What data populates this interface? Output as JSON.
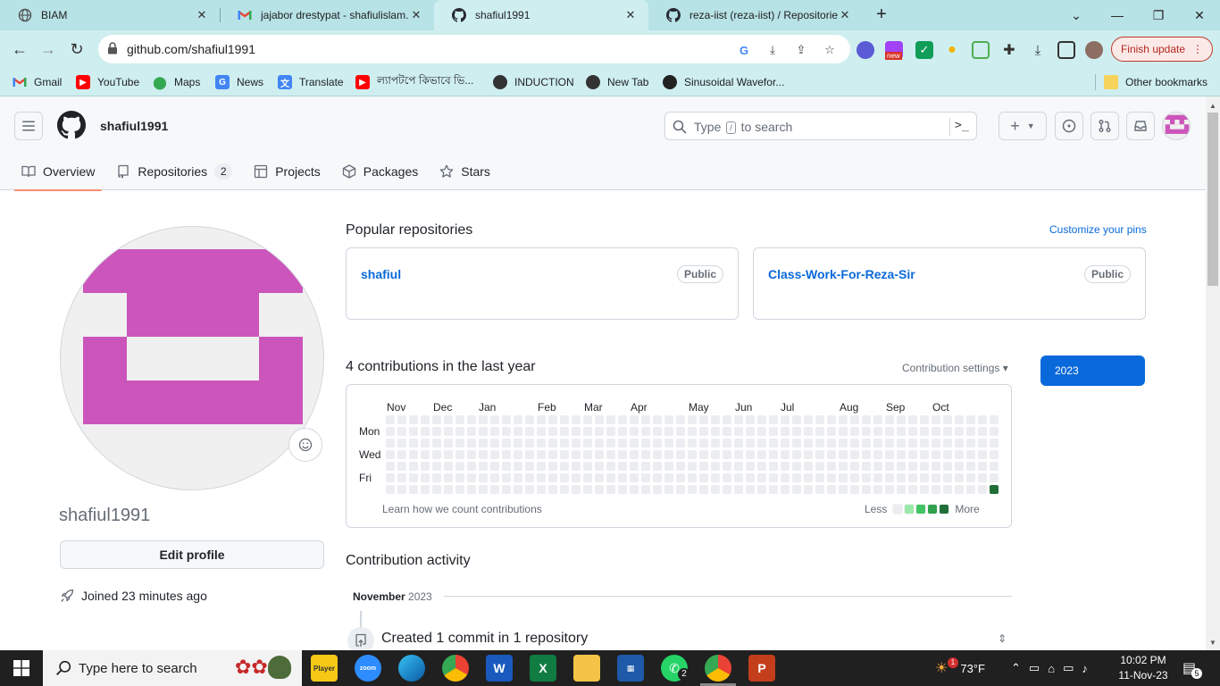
{
  "browser": {
    "tabs": [
      {
        "title": "BIAM",
        "icon": "globe-icon"
      },
      {
        "title": "jajabor drestypat - shafiulislam.m",
        "icon": "gmail-icon"
      },
      {
        "title": "shafiul1991",
        "icon": "github-icon",
        "active": true
      },
      {
        "title": "reza-iist (reza-iist) / Repositories",
        "icon": "github-icon"
      }
    ],
    "url": "github.com/shafiul1991",
    "finish_update": "Finish update",
    "bookmarks": [
      {
        "label": "Gmail",
        "icon": "gmail-icon"
      },
      {
        "label": "YouTube",
        "icon": "youtube-icon"
      },
      {
        "label": "Maps",
        "icon": "maps-icon"
      },
      {
        "label": "News",
        "icon": "news-icon"
      },
      {
        "label": "Translate",
        "icon": "translate-icon"
      },
      {
        "label": "ল্যাপটপে কিভাবে ভি...",
        "icon": "youtube-icon"
      },
      {
        "label": "INDUCTION",
        "icon": "globe-icon"
      },
      {
        "label": "New Tab",
        "icon": "globe-icon"
      },
      {
        "label": "Sinusoidal Wavefor...",
        "icon": "globe-icon"
      }
    ],
    "other_bookmarks": "Other bookmarks",
    "ext_badge": "new"
  },
  "github": {
    "username": "shafiul1991",
    "search_prefix": "Type",
    "search_key": "/",
    "search_suffix": "to search",
    "tabs": [
      {
        "label": "Overview",
        "icon": "book-icon"
      },
      {
        "label": "Repositories",
        "icon": "repo-icon",
        "count": "2"
      },
      {
        "label": "Projects",
        "icon": "table-icon"
      },
      {
        "label": "Packages",
        "icon": "package-icon"
      },
      {
        "label": "Stars",
        "icon": "star-icon"
      }
    ]
  },
  "profile": {
    "login": "shafiul1991",
    "edit_profile": "Edit profile",
    "joined": "Joined 23 minutes ago"
  },
  "main": {
    "popular_title": "Popular repositories",
    "customize_pins": "Customize your pins",
    "pins": [
      {
        "name": "shafiul",
        "visibility": "Public"
      },
      {
        "name": "Class-Work-For-Reza-Sir",
        "visibility": "Public"
      }
    ],
    "contrib_title": "4 contributions in the last year",
    "contrib_settings": "Contribution settings ▾",
    "year": "2023",
    "months": [
      "Nov",
      "Dec",
      "Jan",
      "Feb",
      "Mar",
      "Apr",
      "May",
      "Jun",
      "Jul",
      "Aug",
      "Sep",
      "Oct"
    ],
    "weekdays": [
      "Mon",
      "Wed",
      "Fri"
    ],
    "learn_link": "Learn how we count contributions",
    "legend_less": "Less",
    "legend_more": "More",
    "activity_title": "Contribution activity",
    "activity_month": "November",
    "activity_year": "2023",
    "activity_item": "Created 1 commit in 1 repository"
  },
  "colors": {
    "accent": "#0969da",
    "tab_underline": "#fd8c73",
    "avatar": "#cc55bb",
    "level0": "#ebedf0",
    "level1": "#9be9a8",
    "level2": "#40c463",
    "level3": "#30a14e",
    "level4": "#216e39"
  },
  "taskbar": {
    "search_placeholder": "Type here to search",
    "weather": "73°F",
    "weather_badge": "1",
    "time": "10:02 PM",
    "date": "11-Nov-23",
    "notification_count": "5",
    "whatsapp_badge": "2"
  }
}
